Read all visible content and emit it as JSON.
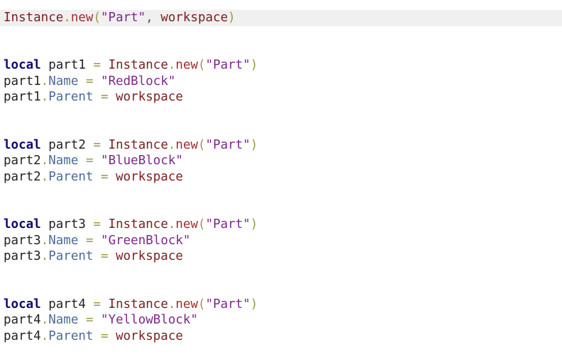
{
  "editor": {
    "line1": {
      "cls": "Instance",
      "fn": "new",
      "open": "(",
      "str": "\"Part\"",
      "comma": ",",
      "ws": "workspace",
      "close": ")"
    },
    "blocks": [
      {
        "kw": "local",
        "var": "part1",
        "eq": "=",
        "cls": "Instance",
        "fn": "new",
        "open": "(",
        "str": "\"Part\"",
        "close": ")",
        "name_var": "part1",
        "name_prop": "Name",
        "name_eq": "=",
        "name_val": "\"RedBlock\"",
        "parent_var": "part1",
        "parent_prop": "Parent",
        "parent_eq": "=",
        "parent_val": "workspace"
      },
      {
        "kw": "local",
        "var": "part2",
        "eq": "=",
        "cls": "Instance",
        "fn": "new",
        "open": "(",
        "str": "\"Part\"",
        "close": ")",
        "name_var": "part2",
        "name_prop": "Name",
        "name_eq": "=",
        "name_val": "\"BlueBlock\"",
        "parent_var": "part2",
        "parent_prop": "Parent",
        "parent_eq": "=",
        "parent_val": "workspace"
      },
      {
        "kw": "local",
        "var": "part3",
        "eq": "=",
        "cls": "Instance",
        "fn": "new",
        "open": "(",
        "str": "\"Part\"",
        "close": ")",
        "name_var": "part3",
        "name_prop": "Name",
        "name_eq": "=",
        "name_val": "\"GreenBlock\"",
        "parent_var": "part3",
        "parent_prop": "Parent",
        "parent_eq": "=",
        "parent_val": "workspace"
      },
      {
        "kw": "local",
        "var": "part4",
        "eq": "=",
        "cls": "Instance",
        "fn": "new",
        "open": "(",
        "str": "\"Part\"",
        "close": ")",
        "name_var": "part4",
        "name_prop": "Name",
        "name_eq": "=",
        "name_val": "\"YellowBlock\"",
        "parent_var": "part4",
        "parent_prop": "Parent",
        "parent_eq": "=",
        "parent_val": "workspace"
      }
    ]
  }
}
